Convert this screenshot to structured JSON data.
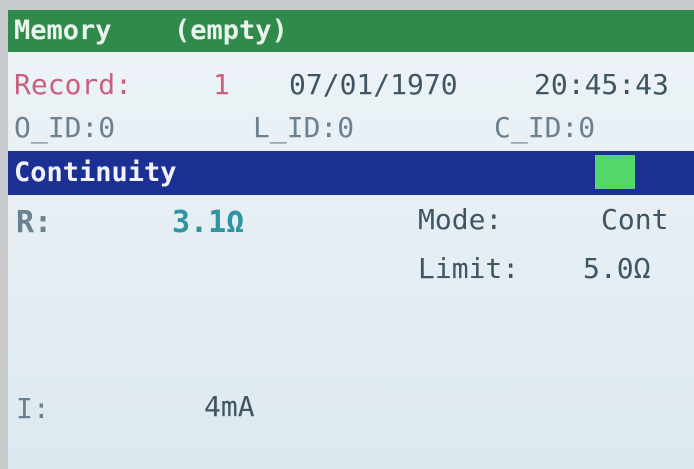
{
  "header": {
    "title": "Memory",
    "state": "(empty)"
  },
  "record": {
    "label": "Record:",
    "number": "1",
    "date": "07/01/1970",
    "time": "20:45:43"
  },
  "ids": {
    "o_id": "O_ID:0",
    "l_id": "L_ID:0",
    "c_id": "C_ID:0"
  },
  "test": {
    "name": "Continuity",
    "status_color": "#54d66b"
  },
  "result": {
    "r_label": "R:",
    "r_value": "3.1Ω",
    "i_label": "I:",
    "i_value": "4mA"
  },
  "settings": {
    "mode_label": "Mode:",
    "mode_value": "Cont",
    "limit_label": "Limit:",
    "limit_value": "5.0Ω"
  },
  "colors": {
    "header_bg": "#2f8a4c",
    "test_bar_bg": "#1c2f92",
    "record_text": "#c8607e",
    "result_value": "#2f93a0"
  }
}
